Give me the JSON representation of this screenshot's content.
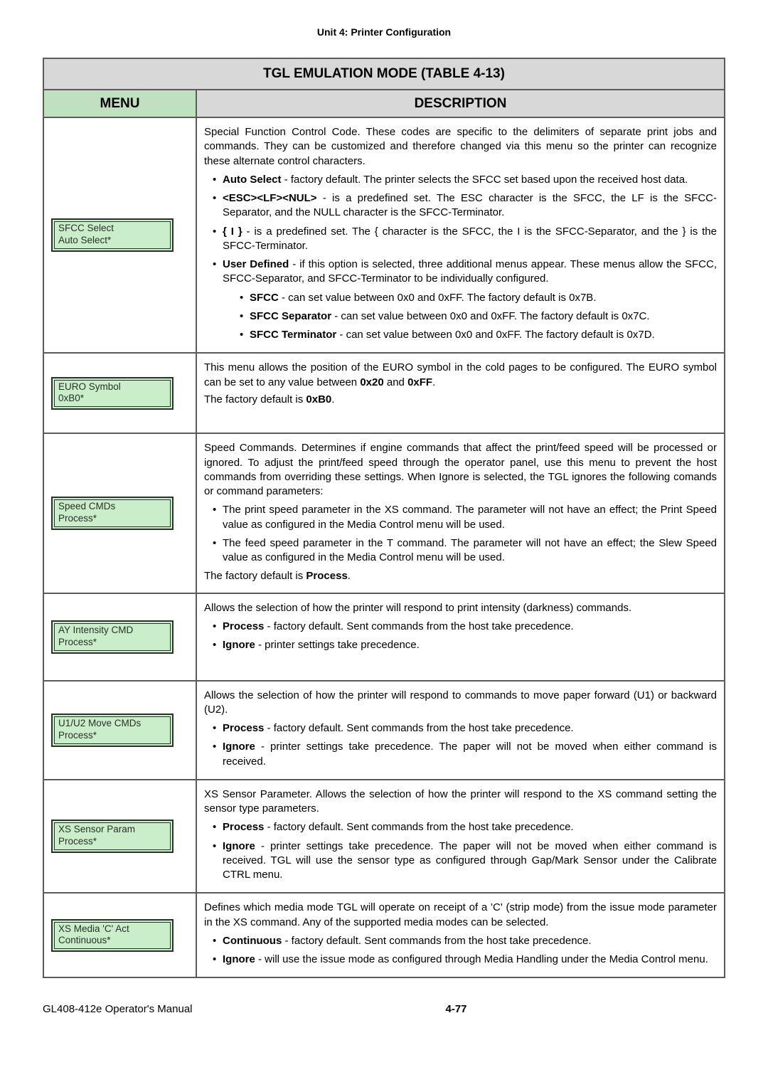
{
  "header": {
    "unit": "Unit 4:  Printer Configuration"
  },
  "table": {
    "title": "TGL EMULATION MODE (TABLE 4-13)",
    "menu_hdr": "MENU",
    "desc_hdr": "DESCRIPTION",
    "rows": [
      {
        "chip1": "SFCC Select",
        "chip2": "Auto Select*",
        "p1": "Special Function Control Code. These codes are specific to the delimiters of separate print jobs and commands. They can be customized and therefore changed via this menu so the printer can recognize these alternate control characters.",
        "b1a": "Auto Select",
        "b1b": " - factory default. The printer selects the SFCC set based upon the received host data.",
        "b2a": "<ESC><LF><NUL>",
        "b2b": " - is a predefined set. The ESC character is the SFCC, the LF is the SFCC-Separator, and the NULL character is the SFCC-Terminator.",
        "b3a": "{ I }",
        "b3b": " - is a predefined set. The { character is the SFCC, the I is the SFCC-Separator, and the } is the SFCC-Terminator.",
        "b4a": "User Defined",
        "b4b": " - if this option is selected, three additional menus appear. These menus allow the SFCC, SFCC-Separator, and SFCC-Terminator to be individually configured.",
        "s1a": "SFCC",
        "s1b": " - can set value between 0x0 and 0xFF. The factory default is 0x7B.",
        "s2a": "SFCC Separator",
        "s2b": " - can set value between 0x0 and 0xFF. The factory default is 0x7C.",
        "s3a": "SFCC Terminator",
        "s3b": " - can set value between 0x0 and 0xFF. The factory default is 0x7D."
      },
      {
        "chip1": "EURO Symbol",
        "chip2": "0xB0*",
        "p1a": "This menu allows the position of the EURO symbol in the cold pages to be configured. The EURO symbol can be set to any value between ",
        "p1b": "0x20",
        "p1c": " and ",
        "p1d": "0xFF",
        "p1e": ".",
        "p2a": "The factory default is ",
        "p2b": "0xB0",
        "p2c": "."
      },
      {
        "chip1": "Speed CMDs",
        "chip2": "Process*",
        "p1": "Speed Commands. Determines if engine commands that affect the print/feed speed will be processed or ignored. To adjust the print/feed speed through the operator panel, use this menu to prevent the host commands from overriding these settings. When Ignore is selected, the TGL ignores the following comands or command parameters:",
        "b1": "The print speed parameter in the XS command. The parameter will not have an effect; the Print Speed value as configured in the Media Control menu will be used.",
        "b2": "The feed speed parameter in the T command. The parameter will not have an effect; the Slew Speed value as configured in the Media Control menu will be used.",
        "p2a": "The factory default is ",
        "p2b": "Process",
        "p2c": "."
      },
      {
        "chip1": "AY Intensity CMD",
        "chip2": "Process*",
        "p1": "Allows the selection of how the printer will respond to print intensity (darkness) commands.",
        "b1a": "Process",
        "b1b": " - factory default. Sent commands from the host take precedence.",
        "b2a": "Ignore",
        "b2b": " - printer settings take precedence."
      },
      {
        "chip1": "U1/U2 Move CMDs",
        "chip2": "Process*",
        "p1": "Allows the selection of how the printer will respond to commands to move paper forward (U1) or backward (U2).",
        "b1a": "Process",
        "b1b": " - factory default. Sent commands from the host take precedence.",
        "b2a": "Ignore",
        "b2b": " - printer settings take precedence. The paper will not be moved when either command is received."
      },
      {
        "chip1": "XS Sensor Param",
        "chip2": "Process*",
        "p1": "XS Sensor Parameter. Allows the selection of how the printer will respond to the XS command setting the sensor type parameters.",
        "b1a": "Process",
        "b1b": " - factory default. Sent commands from the host take precedence.",
        "b2a": "Ignore",
        "b2b": " - printer settings take precedence. The paper will not be moved when either command is received. TGL will use the sensor type as configured through Gap/Mark Sensor under the Calibrate CTRL menu."
      },
      {
        "chip1": "XS Media 'C' Act",
        "chip2": "Continuous*",
        "p1": "Defines which media mode TGL will operate on receipt of a 'C' (strip mode) from the issue mode parameter in the XS command. Any of the supported media modes can be selected.",
        "b1a": "Continuous",
        "b1b": " - factory default. Sent commands from the host take precedence.",
        "b2a": "Ignore",
        "b2b": " - will use the issue mode as configured through Media Handling under the Media Control menu."
      }
    ]
  },
  "footer": {
    "left": "GL408-412e Operator's Manual",
    "page": "4-77"
  }
}
